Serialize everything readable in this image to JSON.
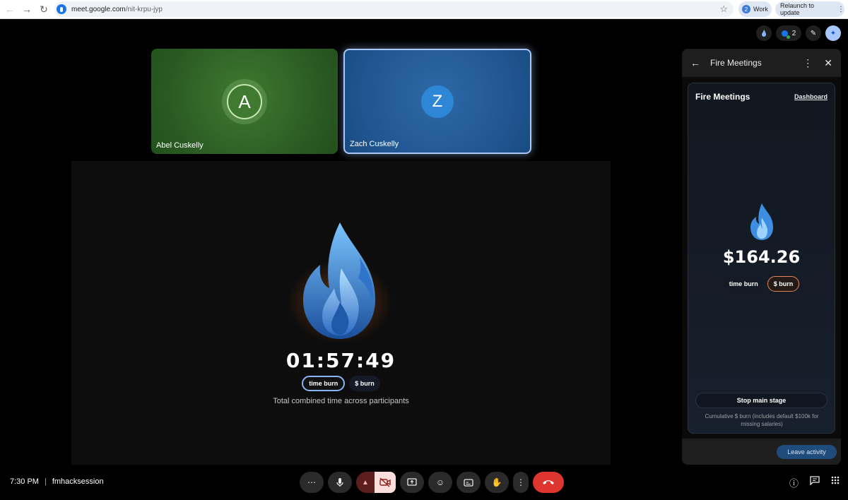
{
  "browser": {
    "url_host": "meet.google.com",
    "url_path": "/nit-krpu-jyp",
    "profile_count": "2",
    "profile_label": "Work",
    "relaunch_label": "Relaunch to update"
  },
  "top_icons": {
    "people_count": "2"
  },
  "tiles": [
    {
      "initial": "A",
      "name": "Abel Cuskelly",
      "color": "#2a5a22"
    },
    {
      "initial": "Z",
      "name": "Zach Cuskelly",
      "color": "#1f5590"
    }
  ],
  "stage": {
    "timer": "01:57:49",
    "toggle_time": "time burn",
    "toggle_money": "$ burn",
    "caption": "Total combined time across participants"
  },
  "panel": {
    "header_title": "Fire Meetings",
    "card_title": "Fire Meetings",
    "dashboard_link": "Dashboard",
    "amount": "$164.26",
    "toggle_time": "time burn",
    "toggle_money": "$ burn",
    "stop_label": "Stop main stage",
    "note": "Cumulative $ burn (includes default $100k for missing salaries)",
    "leave_label": "Leave activity"
  },
  "bottom": {
    "time": "7:30 PM",
    "meeting_name": "fmhacksession"
  },
  "colors": {
    "accent": "#8ab4f8",
    "hangup": "#dc362e",
    "money_accent": "#e8845a"
  }
}
